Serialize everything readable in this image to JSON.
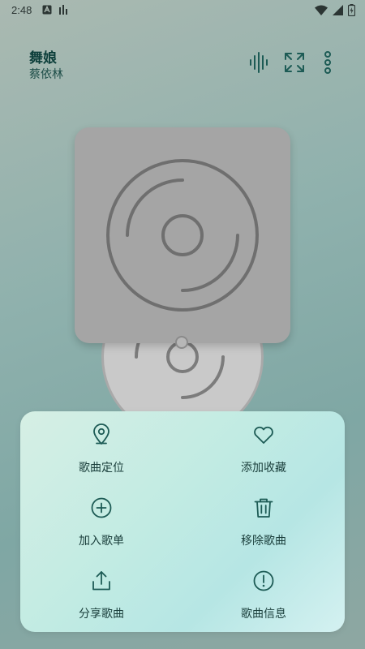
{
  "status_bar": {
    "time": "2:48"
  },
  "header": {
    "title": "舞娘",
    "artist": "蔡依林"
  },
  "actions": [
    {
      "id": "locate",
      "label": "歌曲定位",
      "icon": "location-pin-icon"
    },
    {
      "id": "favorite",
      "label": "添加收藏",
      "icon": "heart-icon"
    },
    {
      "id": "add-to-list",
      "label": "加入歌单",
      "icon": "plus-circle-icon"
    },
    {
      "id": "remove",
      "label": "移除歌曲",
      "icon": "trash-icon"
    },
    {
      "id": "share",
      "label": "分享歌曲",
      "icon": "share-icon"
    },
    {
      "id": "info",
      "label": "歌曲信息",
      "icon": "info-icon"
    }
  ],
  "colors": {
    "accent": "#1d5b55",
    "text": "#1a3e3b",
    "album_bg": "#a5a5a5"
  }
}
